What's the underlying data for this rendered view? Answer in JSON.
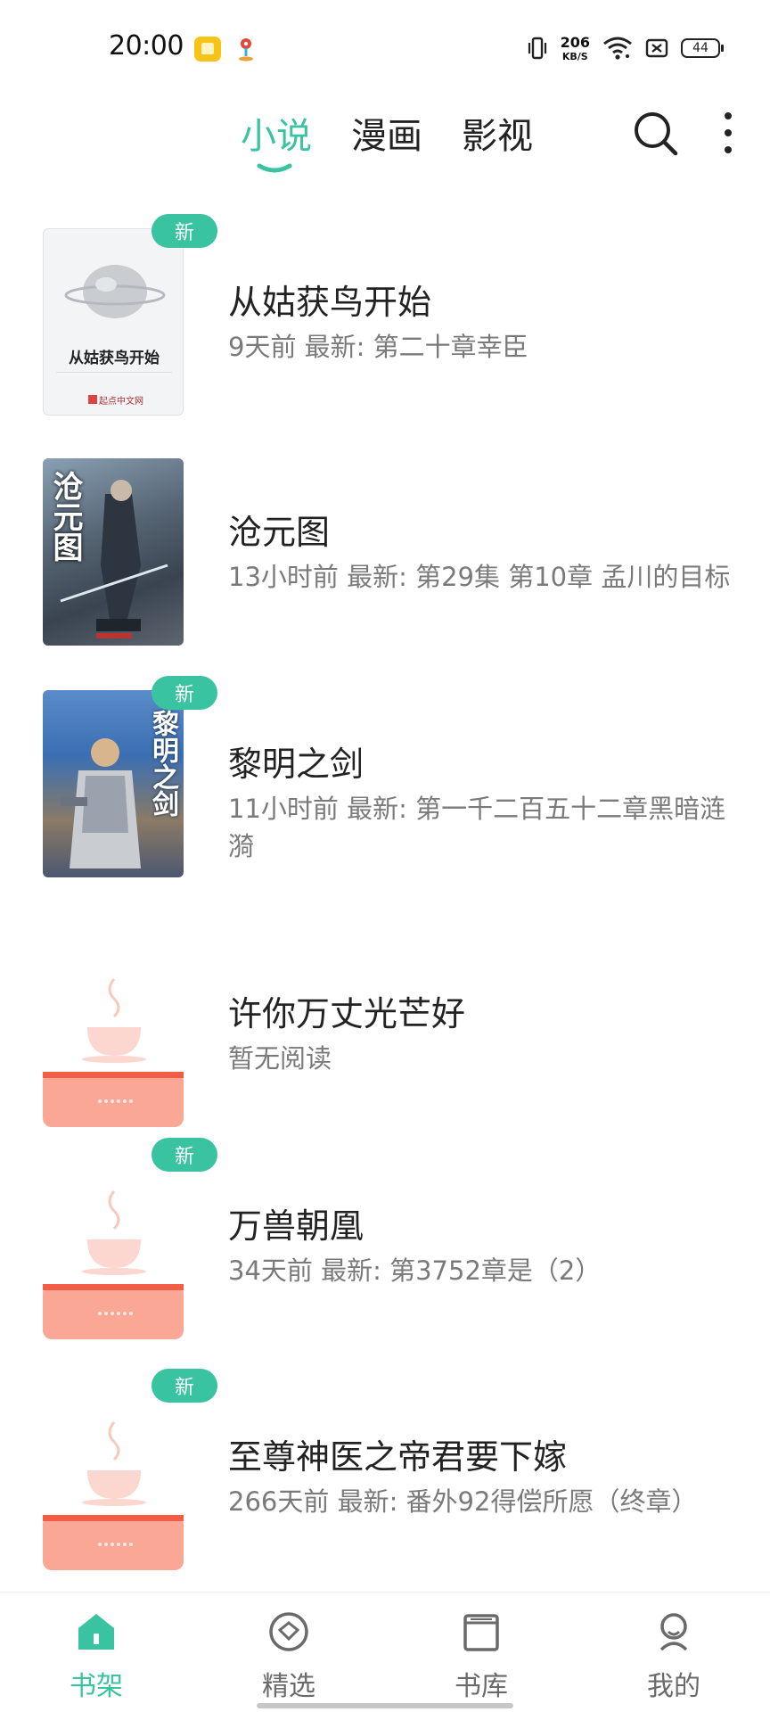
{
  "status_bar": {
    "time": "20:00",
    "net_speed_value": "206",
    "net_speed_unit": "KB/S",
    "battery": "44",
    "icons": [
      "yellow-app-icon",
      "location-icon",
      "vibrate-icon",
      "wifi-icon",
      "sim-off-icon",
      "battery-icon"
    ]
  },
  "top_tabs": {
    "tabs": [
      {
        "label": "小说",
        "active": true
      },
      {
        "label": "漫画",
        "active": false
      },
      {
        "label": "影视",
        "active": false
      }
    ],
    "accent": "#3ac3a0",
    "icons": [
      "search-icon",
      "more-icon"
    ]
  },
  "books": [
    {
      "title": "从姑获鸟开始",
      "meta": "9天前 最新: 第二十章幸臣",
      "badge": "新",
      "cover_title": "从姑获鸟开始",
      "cover_footer": "起点中文网"
    },
    {
      "title": "沧元图",
      "meta": "13小时前 最新: 第29集 第10章 孟川的目标",
      "badge": "",
      "cover_title": "沧元图"
    },
    {
      "title": "黎明之剑",
      "meta": "11小时前 最新: 第一千二百五十二章黑暗涟漪",
      "badge": "新",
      "cover_title": "黎明之剑"
    },
    {
      "title": "许你万丈光芒好",
      "meta": "暂无阅读",
      "badge": "",
      "cover_title": ""
    },
    {
      "title": "万兽朝凰",
      "meta": "34天前 最新: 第3752章是（2）",
      "badge": "新",
      "cover_title": ""
    },
    {
      "title": "至尊神医之帝君要下嫁",
      "meta": "266天前 最新: 番外92得偿所愿（终章）",
      "badge": "新",
      "cover_title": ""
    }
  ],
  "bottom_nav": {
    "items": [
      {
        "label": "书架",
        "icon": "bookshelf-icon",
        "active": true
      },
      {
        "label": "精选",
        "icon": "featured-icon",
        "active": false
      },
      {
        "label": "书库",
        "icon": "library-icon",
        "active": false
      },
      {
        "label": "我的",
        "icon": "profile-icon",
        "active": false
      }
    ]
  }
}
